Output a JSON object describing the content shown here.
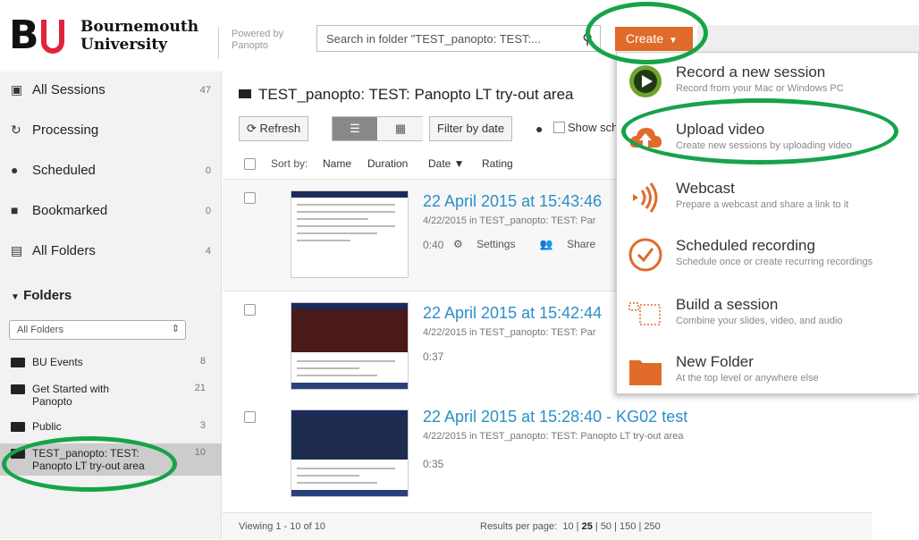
{
  "brand": {
    "logo_letters": "BU",
    "name_line1": "Bournemouth",
    "name_line2": "University",
    "powered_line1": "Powered by",
    "powered_line2": "Panopto"
  },
  "search": {
    "text": "Search in folder \"TEST_panopto: TEST:..."
  },
  "create": {
    "label": "Create",
    "caret": "▼"
  },
  "sidebar": {
    "items": [
      {
        "label": "All Sessions",
        "count": "47",
        "icon": "sessions-icon"
      },
      {
        "label": "Processing",
        "count": "",
        "icon": "processing-icon"
      },
      {
        "label": "Scheduled",
        "count": "0",
        "icon": "clock-icon"
      },
      {
        "label": "Bookmarked",
        "count": "0",
        "icon": "bookmark-icon"
      },
      {
        "label": "All Folders",
        "count": "4",
        "icon": "folders-icon"
      }
    ],
    "folders_heading": "Folders",
    "folder_filter": "All Folders",
    "folders": [
      {
        "label": "BU Events",
        "count": "8"
      },
      {
        "label": "Get Started with Panopto",
        "count": "21"
      },
      {
        "label": "Public",
        "count": "3"
      },
      {
        "label": "TEST_panopto: TEST: Panopto LT try-out area",
        "count": "10"
      }
    ]
  },
  "main": {
    "breadcrumb": "TEST_panopto: TEST: Panopto LT try-out area",
    "refresh_label": "Refresh",
    "filter_label": "Filter by date",
    "show_label": "Show sch",
    "sort_by": "Sort by:",
    "sort_options": [
      "Name",
      "Duration",
      "Date ▼",
      "Rating"
    ],
    "sessions": [
      {
        "title": "22 April 2015 at 15:43:46",
        "meta": "4/22/2015 in TEST_panopto: TEST: Par",
        "duration": "0:40",
        "settings": "Settings",
        "share": "Share"
      },
      {
        "title": "22 April 2015 at 15:42:44",
        "meta": "4/22/2015 in TEST_panopto: TEST: Par",
        "duration": "0:37"
      },
      {
        "title": "22 April 2015 at 15:28:40 - KG02 test",
        "meta": "4/22/2015 in TEST_panopto: TEST: Panopto LT try-out area",
        "duration": "0:35"
      }
    ],
    "viewing": "Viewing 1 - 10 of 10",
    "results_label": "Results per page:",
    "results_options": [
      "10",
      "25",
      "50",
      "150",
      "250"
    ],
    "results_selected": "25"
  },
  "create_menu": [
    {
      "title": "Record a new session",
      "desc": "Record from your Mac or Windows PC",
      "icon": "record-icon"
    },
    {
      "title": "Upload video",
      "desc": "Create new sessions by uploading video",
      "icon": "upload-cloud-icon"
    },
    {
      "title": "Webcast",
      "desc": "Prepare a webcast and share a link to it",
      "icon": "webcast-icon"
    },
    {
      "title": "Scheduled recording",
      "desc": "Schedule once or create recurring recordings",
      "icon": "scheduled-recording-icon"
    },
    {
      "title": "Build a session",
      "desc": "Combine your slides, video, and audio",
      "icon": "build-session-icon"
    },
    {
      "title": "New Folder",
      "desc": "At the top level or anywhere else",
      "icon": "new-folder-icon"
    }
  ],
  "colors": {
    "accent": "#e06b2b",
    "link": "#2a8fc7",
    "highlight_ring": "#16a34a"
  }
}
